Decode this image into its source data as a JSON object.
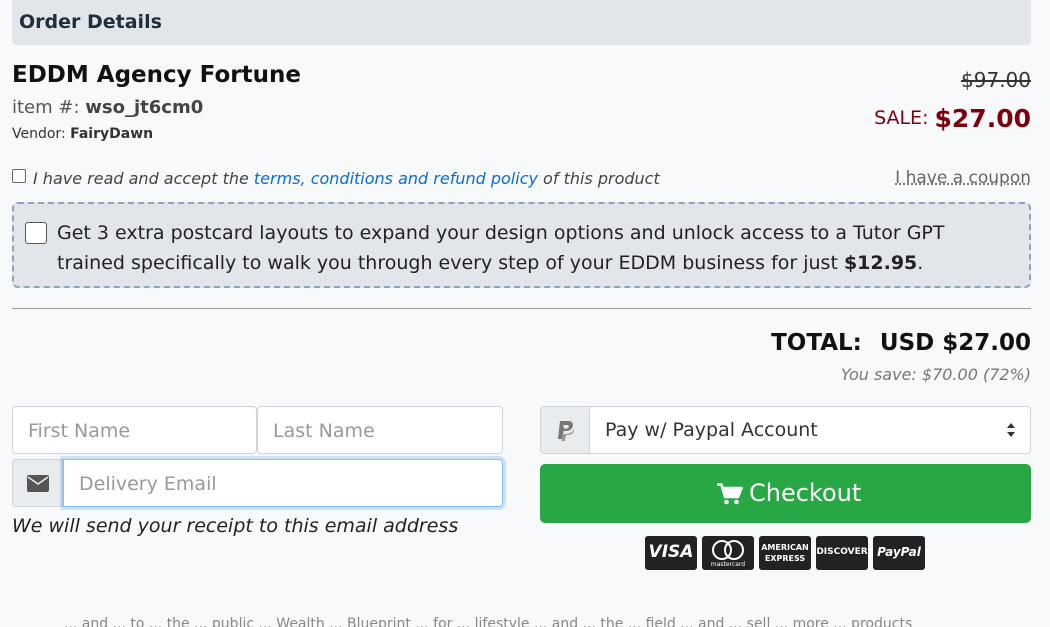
{
  "header": {
    "title": "Order Details"
  },
  "product": {
    "title": "EDDM Agency Fortune",
    "item_label": "item #: ",
    "item_id": "wso_jt6cm0",
    "vendor_label": "Vendor: ",
    "vendor": "FairyDawn",
    "old_price": "$97.00",
    "sale_label": "SALE: ",
    "sale_price": "$27.00"
  },
  "terms": {
    "prefix": "I have read and accept the ",
    "link": "terms, conditions and refund policy",
    "suffix": " of this product",
    "coupon": "I have a coupon"
  },
  "upsell": {
    "text": "Get 3 extra postcard layouts to expand your design options and unlock access to a Tutor GPT trained specifically to walk you through every step of your EDDM business for just ",
    "price": "$12.95",
    "end": "."
  },
  "totals": {
    "label": "TOTAL:",
    "amount": "USD $27.00",
    "savings": "You save: $70.00 (72%)"
  },
  "form": {
    "first_name_placeholder": "First Name",
    "last_name_placeholder": "Last Name",
    "email_placeholder": "Delivery Email",
    "email_note": "We will send your receipt to this email address"
  },
  "payment": {
    "method": "Pay w/ Paypal Account",
    "checkout_label": "Checkout"
  },
  "cards": {
    "visa": "VISA",
    "mastercard": "mastercard",
    "amex_1": "AMERICAN",
    "amex_2": "EXPRESS",
    "discover": "DISCOVER",
    "paypal": "PayPal"
  },
  "colors": {
    "checkout": "#28a745",
    "sale": "#7a0010",
    "link": "#0a6cd6"
  },
  "footer": {
    "cut_text": "... and ... to ... the ... public ... Wealth ... Blueprint ... for ... lifestyle ... and ... the ... field ... and ... sell ... more ... products"
  }
}
